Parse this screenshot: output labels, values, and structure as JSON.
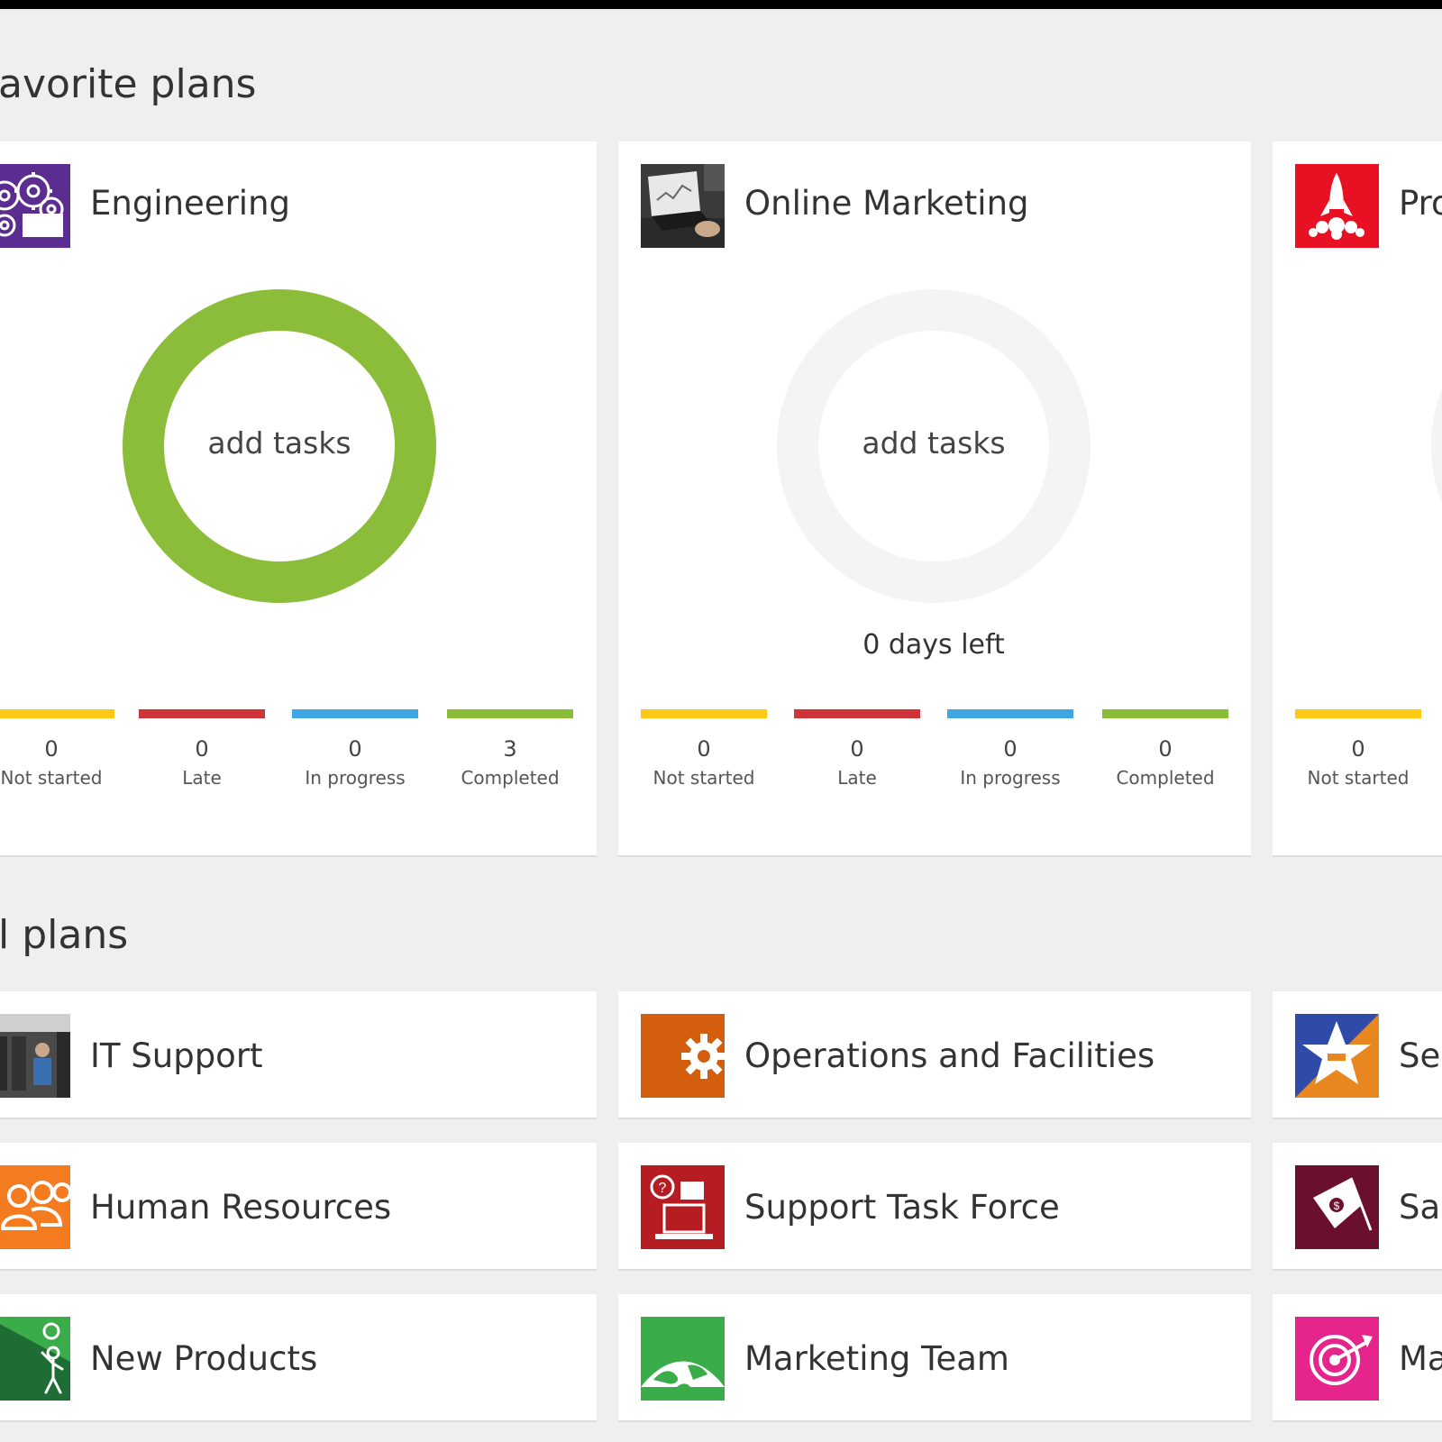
{
  "favorites": {
    "title": "avorite plans",
    "cards": [
      {
        "name": "Engineering",
        "icon": "gears-icon",
        "icon_bg": "#5c2d91",
        "center_label": "add tasks",
        "donut_color": "#8bbd3a",
        "days_left": "",
        "stats": [
          {
            "count": "0",
            "label": "Not started",
            "color": "#fcc914"
          },
          {
            "count": "0",
            "label": "Late",
            "color": "#d13438"
          },
          {
            "count": "0",
            "label": "In progress",
            "color": "#3fa5e3"
          },
          {
            "count": "3",
            "label": "Completed",
            "color": "#8bbd3a"
          }
        ]
      },
      {
        "name": "Online Marketing",
        "icon": "laptop-photo-icon",
        "icon_bg": "#3a3a3a",
        "center_label": "add tasks",
        "donut_color": "#f4f4f4",
        "days_left": "0 days left",
        "stats": [
          {
            "count": "0",
            "label": "Not started",
            "color": "#fcc914"
          },
          {
            "count": "0",
            "label": "Late",
            "color": "#d13438"
          },
          {
            "count": "0",
            "label": "In progress",
            "color": "#3fa5e3"
          },
          {
            "count": "0",
            "label": "Completed",
            "color": "#8bbd3a"
          }
        ]
      },
      {
        "name": "Pro",
        "icon": "rocket-icon",
        "icon_bg": "#e81123",
        "stats": [
          {
            "count": "0",
            "label": "Not started",
            "color": "#fcc914"
          }
        ]
      }
    ]
  },
  "all_plans": {
    "title": "l plans",
    "rows": [
      [
        {
          "name": "IT Support",
          "icon": "it-support-photo-icon",
          "icon_bg": "#4a4a4a"
        },
        {
          "name": "Operations and Facilities",
          "icon": "gear-icon",
          "icon_bg": "#d35e0e"
        },
        {
          "name": "Ser",
          "icon": "star-icon",
          "icon_bg": "#2f4aa8"
        }
      ],
      [
        {
          "name": "Human Resources",
          "icon": "people-icon",
          "icon_bg": "#f47b20"
        },
        {
          "name": "Support Task Force",
          "icon": "help-desk-icon",
          "icon_bg": "#b51d22"
        },
        {
          "name": "Sal",
          "icon": "money-flag-icon",
          "icon_bg": "#6b0f2e"
        }
      ],
      [
        {
          "name": "New Products",
          "icon": "lightbulb-person-icon",
          "icon_bg": "#1e6d35"
        },
        {
          "name": "Marketing Team",
          "icon": "globe-icon",
          "icon_bg": "#3aad4a"
        },
        {
          "name": "Ma",
          "icon": "target-icon",
          "icon_bg": "#e5258c"
        }
      ]
    ]
  }
}
